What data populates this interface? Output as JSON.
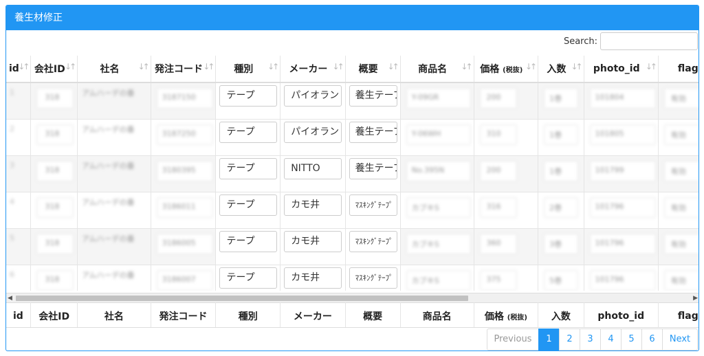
{
  "panel": {
    "title": "養生材修正"
  },
  "search": {
    "label": "Search:",
    "value": ""
  },
  "columns": [
    "id",
    "会社ID",
    "社名",
    "発注コード",
    "種別",
    "メーカー",
    "概要",
    "商品名",
    "価格",
    "(税抜)",
    "入数",
    "photo_id",
    "flag"
  ],
  "rows": [
    {
      "id": "1",
      "type": "テープ",
      "maker": "パイオラン",
      "summary": "養生テープ",
      "company_id": "318",
      "company": "アムハーデの番",
      "order_code": "3187150",
      "product": "Y-09GR",
      "price": "200",
      "qty": "1巻",
      "photo": "101804",
      "flag": "有効"
    },
    {
      "id": "2",
      "type": "テープ",
      "maker": "パイオラン",
      "summary": "養生テープ",
      "company_id": "318",
      "company": "アムハーデの番",
      "order_code": "3187250",
      "product": "Y-06WH",
      "price": "310",
      "qty": "1巻",
      "photo": "101805",
      "flag": "有効"
    },
    {
      "id": "3",
      "type": "テープ",
      "maker": "NITTO",
      "summary": "養生テープ",
      "company_id": "318",
      "company": "アムハーデの番",
      "order_code": "3180395",
      "product": "No.395N",
      "price": "200",
      "qty": "1巻",
      "photo": "101799",
      "flag": "有効"
    },
    {
      "id": "4",
      "type": "テープ",
      "maker": "カモ井",
      "summary": "ﾏｽｷﾝｸﾞﾃｰﾌﾟ",
      "company_id": "318",
      "company": "アムハーデの番",
      "order_code": "3186011",
      "product": "カブキS",
      "price": "316",
      "qty": "2巻",
      "photo": "101796",
      "flag": "有効"
    },
    {
      "id": "5",
      "type": "テープ",
      "maker": "カモ井",
      "summary": "ﾏｽｷﾝｸﾞﾃｰﾌﾟ",
      "company_id": "318",
      "company": "アムハーデの番",
      "order_code": "3186005",
      "product": "カブキS",
      "price": "360",
      "qty": "3巻",
      "photo": "101796",
      "flag": "有効"
    },
    {
      "id": "6",
      "type": "テープ",
      "maker": "カモ井",
      "summary": "ﾏｽｷﾝｸﾞﾃｰﾌﾟ",
      "company_id": "318",
      "company": "アムハーデの番",
      "order_code": "3186007",
      "product": "カブキS",
      "price": "375",
      "qty": "5巻",
      "photo": "101796",
      "flag": "有効"
    }
  ],
  "pagination": {
    "previous": "Previous",
    "pages": [
      "1",
      "2",
      "3",
      "4",
      "5",
      "6"
    ],
    "active": "1",
    "next": "Next"
  },
  "icons": {
    "sort": "sort-arrows-icon",
    "scroll_left": "scroll-left-arrow-icon",
    "scroll_right": "scroll-right-arrow-icon"
  },
  "colors": {
    "accent": "#2196f3",
    "row_stripe": "#f5f5f5"
  }
}
